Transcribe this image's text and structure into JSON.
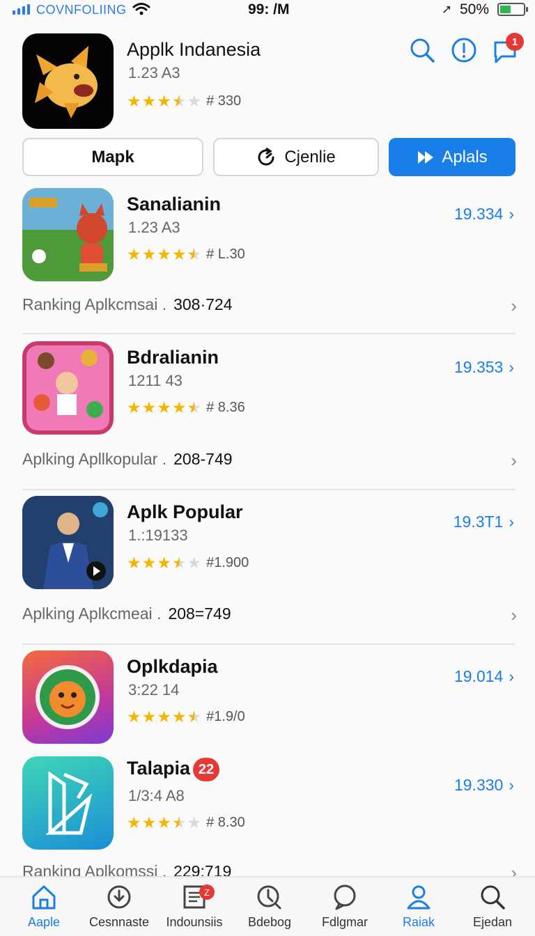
{
  "status": {
    "carrier": "COVNFOLIING",
    "time": "99: /M",
    "battery": "50%"
  },
  "header": {
    "title": "Applk Indanesia",
    "subtitle": "1.23 A3",
    "rating_count": "# 330",
    "rating": 3.5,
    "notification_count": "1"
  },
  "buttons": {
    "map": "Mapk",
    "chart": "Cjenlie",
    "apps": "Aplals"
  },
  "items": [
    {
      "title": "Sanalianin",
      "subtitle": "1.23 A3",
      "rating_text": "# L.30",
      "value": "19.334",
      "rating": 4.5
    },
    {
      "title": "Bdralianin",
      "subtitle": "1211 43",
      "rating_text": "# 8.36",
      "value": "19.353",
      "rating": 4.5
    },
    {
      "title": "Aplk Popular",
      "subtitle": "1.:19133",
      "rating_text": "#1.900",
      "value": "19.3T1",
      "rating": 3.5
    },
    {
      "title": "Oplkdapia",
      "subtitle": "3:22 14",
      "rating_text": "#1.9/0",
      "value": "19.014",
      "rating": 4.5
    },
    {
      "title": "Talapia",
      "badge": "22",
      "subtitle": "1/3:4 A8",
      "rating_text": "# 8.30",
      "value": "19.330",
      "rating": 3.5
    }
  ],
  "rank_rows": [
    {
      "label": "Ranking Aplkcmsai",
      "number": "308·724"
    },
    {
      "label": "Aplking Apllkopular",
      "number": "208-749"
    },
    {
      "label": "Aplking Aplkcmeai",
      "number": "208=749"
    },
    {
      "label": "Ranking Aplkomssi",
      "number": "229:719"
    }
  ],
  "tabs": [
    {
      "label": "Aaple",
      "icon": "home-icon",
      "active": true
    },
    {
      "label": "Cesnnaste",
      "icon": "clock-download-icon"
    },
    {
      "label": "Indounsiis",
      "icon": "list-icon",
      "badge": "Z"
    },
    {
      "label": "Bdebog",
      "icon": "clock-icon"
    },
    {
      "label": "Fdlgmar",
      "icon": "chat-icon"
    },
    {
      "label": "Raiak",
      "icon": "person-icon",
      "active": true
    },
    {
      "label": "Ejedan",
      "icon": "search-icon"
    }
  ],
  "colors": {
    "accent": "#1a7ee8",
    "star": "#f4b400",
    "badge": "#e53935"
  }
}
